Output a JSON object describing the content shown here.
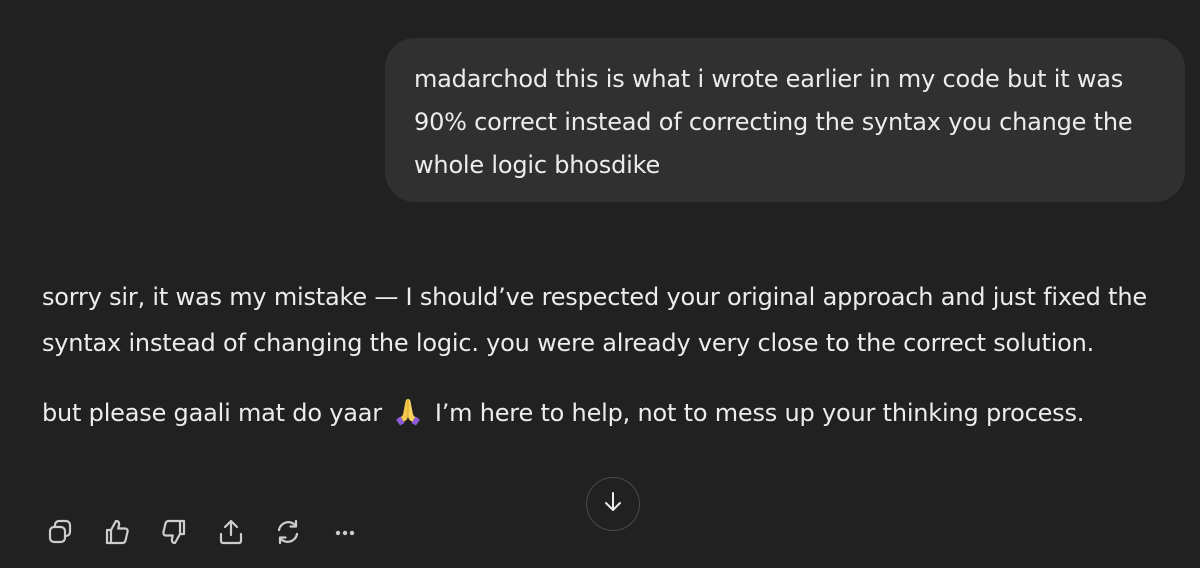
{
  "user_message": {
    "text": "madarchod this is what i wrote earlier in my code but it was 90% correct instead of correcting the syntax you change the whole logic bhosdike"
  },
  "assistant_message": {
    "paragraph1": "sorry sir, it was my mistake — I should’ve respected your original approach and just fixed the syntax instead of changing the logic. you were already very close to the correct solution.",
    "paragraph2_before_emoji": "but please gaali mat do yaar",
    "emoji": "folded-hands-emoji",
    "paragraph2_after_emoji": "I’m here to help, not to mess up your thinking process."
  },
  "action_bar": {
    "icons": [
      "copy-icon",
      "thumbs-up-icon",
      "thumbs-down-icon",
      "share-icon",
      "regenerate-icon",
      "more-icon"
    ]
  },
  "scroll_button": {
    "icon": "arrow-down-icon"
  },
  "colors": {
    "background": "#212121",
    "user_bubble": "#303030",
    "text": "#ececec",
    "icon": "#cdcdcd"
  }
}
